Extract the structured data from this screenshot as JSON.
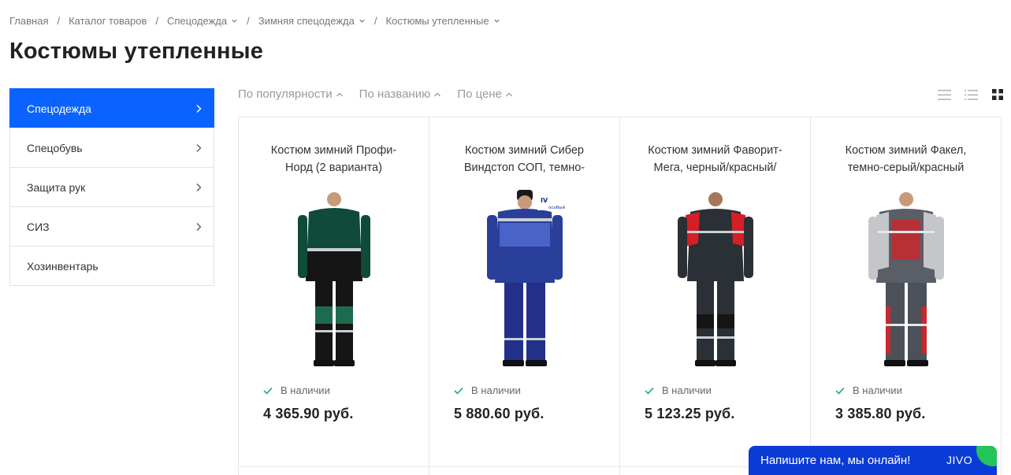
{
  "breadcrumb": [
    {
      "label": "Главная",
      "dropdown": false
    },
    {
      "label": "Каталог товаров",
      "dropdown": false
    },
    {
      "label": "Спецодежда",
      "dropdown": true
    },
    {
      "label": "Зимняя спецодежда",
      "dropdown": true
    },
    {
      "label": "Костюмы утепленные",
      "dropdown": true
    }
  ],
  "breadcrumb_separator": "/",
  "page_title": "Костюмы утепленные",
  "sidebar": {
    "items": [
      {
        "label": "Спецодежда",
        "active": true,
        "has_arrow": true
      },
      {
        "label": "Спецобувь",
        "active": false,
        "has_arrow": true
      },
      {
        "label": "Защита рук",
        "active": false,
        "has_arrow": true
      },
      {
        "label": "СИЗ",
        "active": false,
        "has_arrow": true
      },
      {
        "label": "Хозинвентарь",
        "active": false,
        "has_arrow": false
      }
    ]
  },
  "sort": {
    "options": [
      "По популярности",
      "По названию",
      "По цене"
    ]
  },
  "view_modes": [
    "list-icon",
    "detailed-list-icon",
    "grid-icon"
  ],
  "active_view": "grid-icon",
  "products": [
    {
      "title": "Костюм зимний Профи-Норд (2 варианта)",
      "stock": "В наличии",
      "price": "4 365.90 руб.",
      "colors": {
        "top": "#0f4a3a",
        "bottom": "#151515",
        "accent": "#1d6b4f"
      }
    },
    {
      "title": "Костюм зимний Сибер Виндстоп СОП, темно-",
      "stock": "В наличии",
      "price": "5 880.60 руб.",
      "colors": {
        "top": "#2a3f9a",
        "bottom": "#23308a",
        "accent": "#4a63c8"
      }
    },
    {
      "title": "Костюм зимний Фаворит-Мега, черный/красный/",
      "stock": "В наличии",
      "price": "5 123.25 руб.",
      "colors": {
        "top": "#2b2f36",
        "bottom": "#2b2f36",
        "accent": "#d41f26"
      }
    },
    {
      "title": "Костюм зимний Факел, темно-серый/красный",
      "stock": "В наличии",
      "price": "3 385.80 руб.",
      "colors": {
        "top": "#5a5e66",
        "bottom": "#4c5058",
        "accent": "#c8282e"
      }
    }
  ],
  "badge": {
    "line1": "IV",
    "line2": "особый"
  },
  "chat": {
    "text": "Напишите нам, мы онлайн!",
    "logo": "JIVO"
  },
  "colors": {
    "accent": "#0a63ff",
    "stock_check": "#2fb36b",
    "chat_bg": "#0b3bd6",
    "chat_corner": "#25c45a"
  }
}
